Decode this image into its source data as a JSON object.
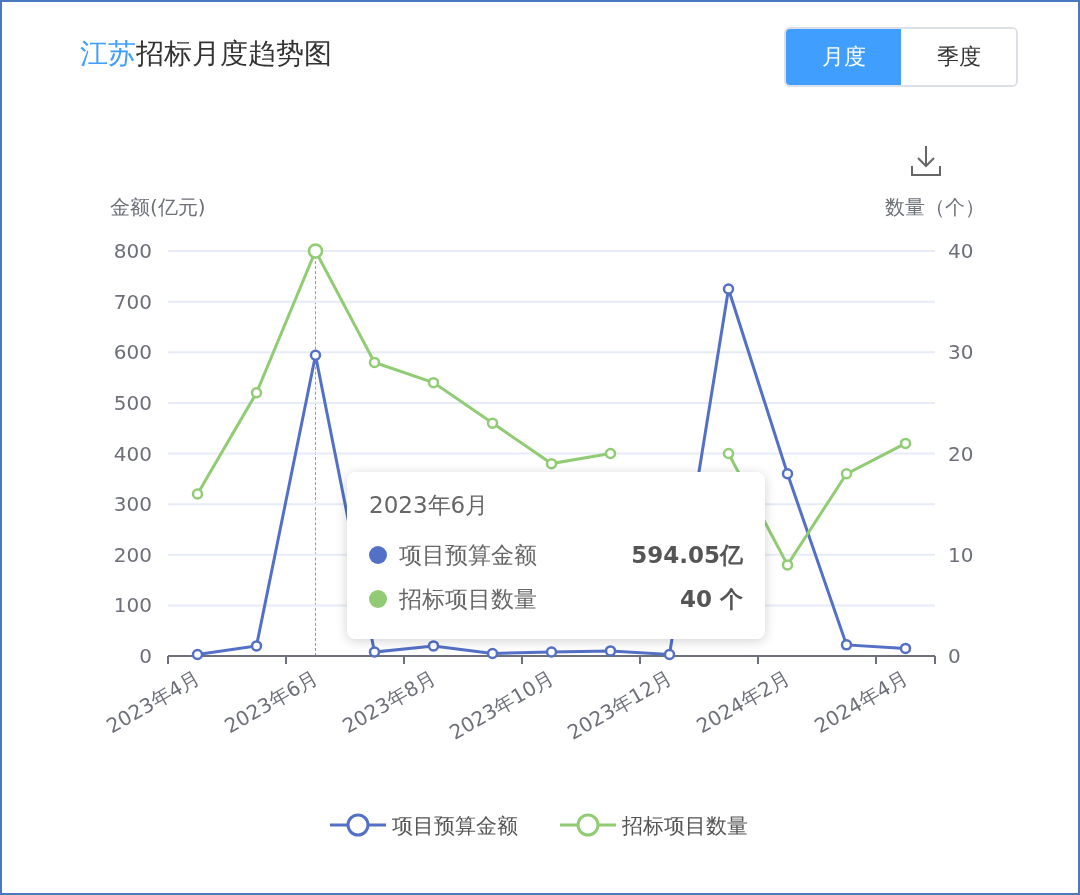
{
  "header": {
    "region": "江苏",
    "title": "招标月度趋势图"
  },
  "tabs": [
    {
      "label": "月度",
      "selected": true
    },
    {
      "label": "季度",
      "selected": false
    }
  ],
  "chart": {
    "left_axis_name": "金额(亿元)",
    "right_axis_name": "数量（个）",
    "chart_data": {
      "type": "line",
      "categories": [
        "2023年4月",
        null,
        "2023年6月",
        null,
        "2023年8月",
        null,
        "2023年10月",
        null,
        "2023年12月",
        null,
        "2024年2月",
        null,
        "2024年4月"
      ],
      "ylim": [
        0,
        800
      ],
      "yticks": [
        0,
        100,
        200,
        300,
        400,
        500,
        600,
        700,
        800
      ],
      "y2lim": [
        0,
        40
      ],
      "y2ticks": [
        0,
        10,
        20,
        30,
        40
      ],
      "series": [
        {
          "name": "项目预算金额",
          "color": "#5470c6",
          "marker": "circle",
          "values": [
            3,
            20,
            594,
            8,
            20,
            5,
            8,
            10,
            3,
            725,
            360,
            22,
            15
          ]
        },
        {
          "name": "招标项目数量",
          "color": "#91cc75",
          "axis": "y2",
          "marker": "circle",
          "values": [
            16,
            26,
            40,
            29,
            27,
            23,
            19,
            20,
            null,
            20,
            9,
            18,
            21
          ]
        }
      ],
      "grid": true,
      "legend": true
    },
    "tooltip": {
      "title": "2023年6月",
      "rows": [
        {
          "label": "项目预算金额",
          "value": "594.05亿",
          "color": "#5470c6"
        },
        {
          "label": "招标项目数量",
          "value": "40 个",
          "color": "#91cc75"
        }
      ]
    }
  }
}
